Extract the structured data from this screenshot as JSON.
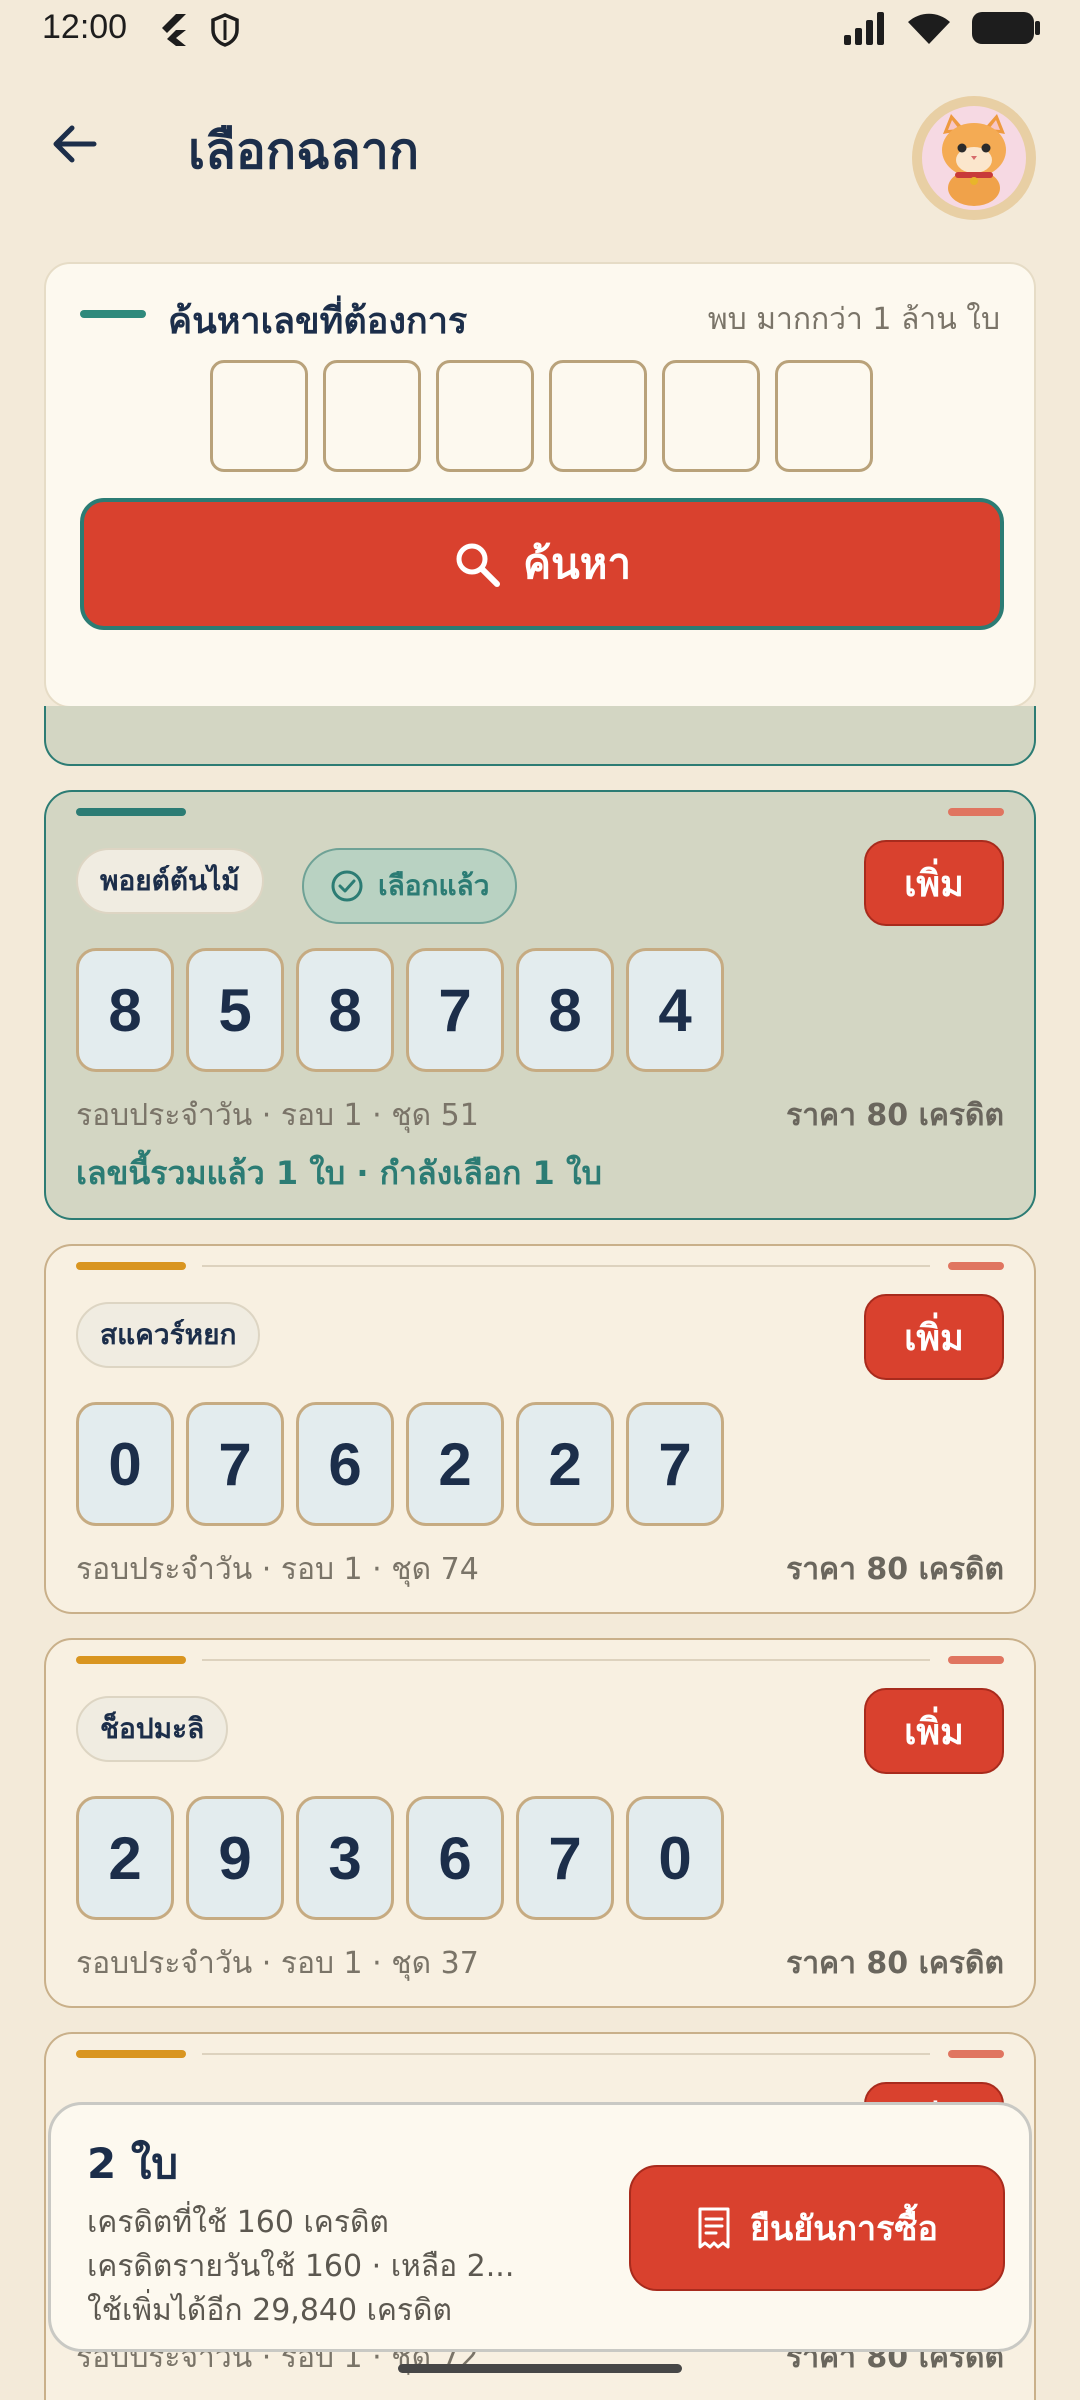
{
  "status": {
    "time": "12:00"
  },
  "header": {
    "title": "เลือกฉลาก"
  },
  "search": {
    "title": "ค้นหาเลขที่ต้องการ",
    "found": "พบ มากกว่า 1 ล้าน ใบ",
    "button_label": "ค้นหา"
  },
  "tickets": [
    {
      "store": "พอยต์ต้นไม้",
      "selected_label": "เลือกแล้ว",
      "add_label": "เพิ่ม",
      "digits": [
        "8",
        "5",
        "8",
        "7",
        "8",
        "4"
      ],
      "meta": "รอบประจำวัน · รอบ 1 · ชุด 51",
      "price": "ราคา 80 เครดิต",
      "note": "เลขนี้รวมแล้ว 1 ใบ · กำลังเลือก 1 ใบ"
    },
    {
      "store": "สแควร์หยก",
      "add_label": "เพิ่ม",
      "digits": [
        "0",
        "7",
        "6",
        "2",
        "2",
        "7"
      ],
      "meta": "รอบประจำวัน · รอบ 1 · ชุด 74",
      "price": "ราคา 80 เครดิต"
    },
    {
      "store": "ช็อปมะลิ",
      "add_label": "เพิ่ม",
      "digits": [
        "2",
        "9",
        "3",
        "6",
        "7",
        "0"
      ],
      "meta": "รอบประจำวัน · รอบ 1 · ชุด 37",
      "price": "ราคา 80 เครดิต"
    },
    {
      "store": "",
      "add_label": "เพิ่ม",
      "digits": [],
      "meta": "รอบประจำวัน · รอบ 1 · ชุด 72",
      "price": "ราคา 80 เครดิต"
    }
  ],
  "summary": {
    "count": "2 ใบ",
    "credit_used": "เครดิตที่ใช้ 160 เครดิต",
    "daily": "เครดิตรายวันใช้ 160 · เหลือ 2...",
    "remaining": "ใช้เพิ่มได้อีก 29,840 เครดิต",
    "confirm_label": "ยืนยันการซื้อ"
  },
  "colors": {
    "background": "#f3ead9",
    "primary_red": "#d9412e",
    "teal": "#2c7c74",
    "navy": "#1c2e4a",
    "selected_card": "#d3d6c3"
  }
}
